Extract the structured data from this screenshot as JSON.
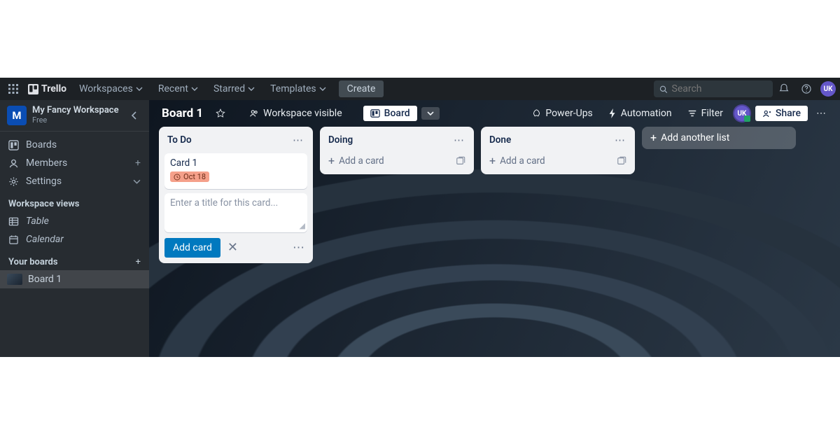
{
  "topnav": {
    "logo_text": "Trello",
    "items": [
      "Workspaces",
      "Recent",
      "Starred",
      "Templates"
    ],
    "create": "Create",
    "search_placeholder": "Search",
    "avatar_initials": "UK"
  },
  "sidebar": {
    "workspace_initial": "M",
    "workspace_name": "My Fancy Workspace",
    "workspace_tier": "Free",
    "nav": [
      {
        "icon": "board",
        "label": "Boards"
      },
      {
        "icon": "user",
        "label": "Members",
        "tail": "+"
      },
      {
        "icon": "gear",
        "label": "Settings",
        "tail": "chevron"
      }
    ],
    "views_heading": "Workspace views",
    "views": [
      {
        "icon": "table",
        "label": "Table"
      },
      {
        "icon": "calendar",
        "label": "Calendar"
      }
    ],
    "boards_heading": "Your boards",
    "boards": [
      {
        "label": "Board 1"
      }
    ]
  },
  "board_header": {
    "title": "Board 1",
    "visibility": "Workspace visible",
    "view_label": "Board",
    "powerups": "Power-Ups",
    "automation": "Automation",
    "filter": "Filter",
    "share": "Share",
    "avatar_initials": "UK"
  },
  "lists": [
    {
      "title": "To Do",
      "cards": [
        {
          "title": "Card 1",
          "due": "Oct 18",
          "due_color": "#f5a08a"
        }
      ],
      "composer": {
        "placeholder": "Enter a title for this card...",
        "submit": "Add card"
      }
    },
    {
      "title": "Doing",
      "add_label": "Add a card"
    },
    {
      "title": "Done",
      "add_label": "Add a card"
    }
  ],
  "add_list_label": "Add another list"
}
